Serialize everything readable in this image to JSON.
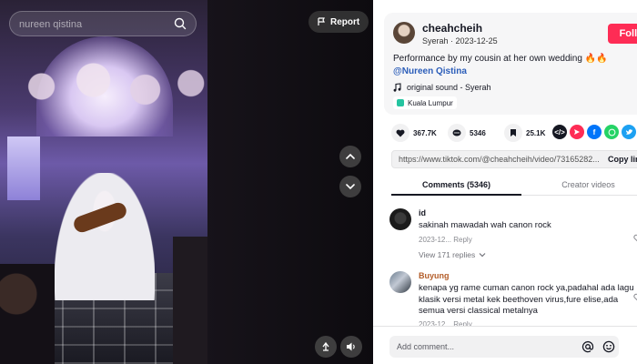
{
  "search": {
    "placeholder": "nureen qistina"
  },
  "video": {
    "report_label": "Report"
  },
  "post": {
    "username": "cheahcheih",
    "sound_title": "Syerah",
    "date": "2023-12-25",
    "follow_label": "Follow",
    "description": "Performance by my cousin at her own wedding 🔥🔥",
    "mention": "@Nureen Qistina",
    "sound": "original sound - Syerah",
    "location": "Kuala Lumpur"
  },
  "stats": {
    "likes": "367.7K",
    "comments": "5346",
    "saves": "25.1K"
  },
  "share": {
    "icons": [
      "embed-icon",
      "send-icon",
      "facebook-icon",
      "whatsapp-icon",
      "twitter-icon"
    ],
    "colors": [
      "#161823",
      "#fe2c55",
      "#0075fa",
      "#25d366",
      "#1da1f2"
    ]
  },
  "link": {
    "url": "https://www.tiktok.com/@cheahcheih/video/73165282...",
    "copy_label": "Copy link"
  },
  "tabs": {
    "comments": "Comments (5346)",
    "creator_videos": "Creator videos"
  },
  "comments": [
    {
      "user": "id",
      "text": "sakinah mawadah wah canon rock",
      "meta": "2023-12... Reply",
      "replies": "View 171 replies"
    },
    {
      "user": "Buyung",
      "text": "kenapa yg rame cuman canon rock ya,padahal ada lagu klasik versi metal kek beethoven virus,fure elise,ada semua versi classical metalnya",
      "meta": "2023-12... Reply"
    }
  ],
  "comment_input": {
    "placeholder": "Add comment..."
  }
}
